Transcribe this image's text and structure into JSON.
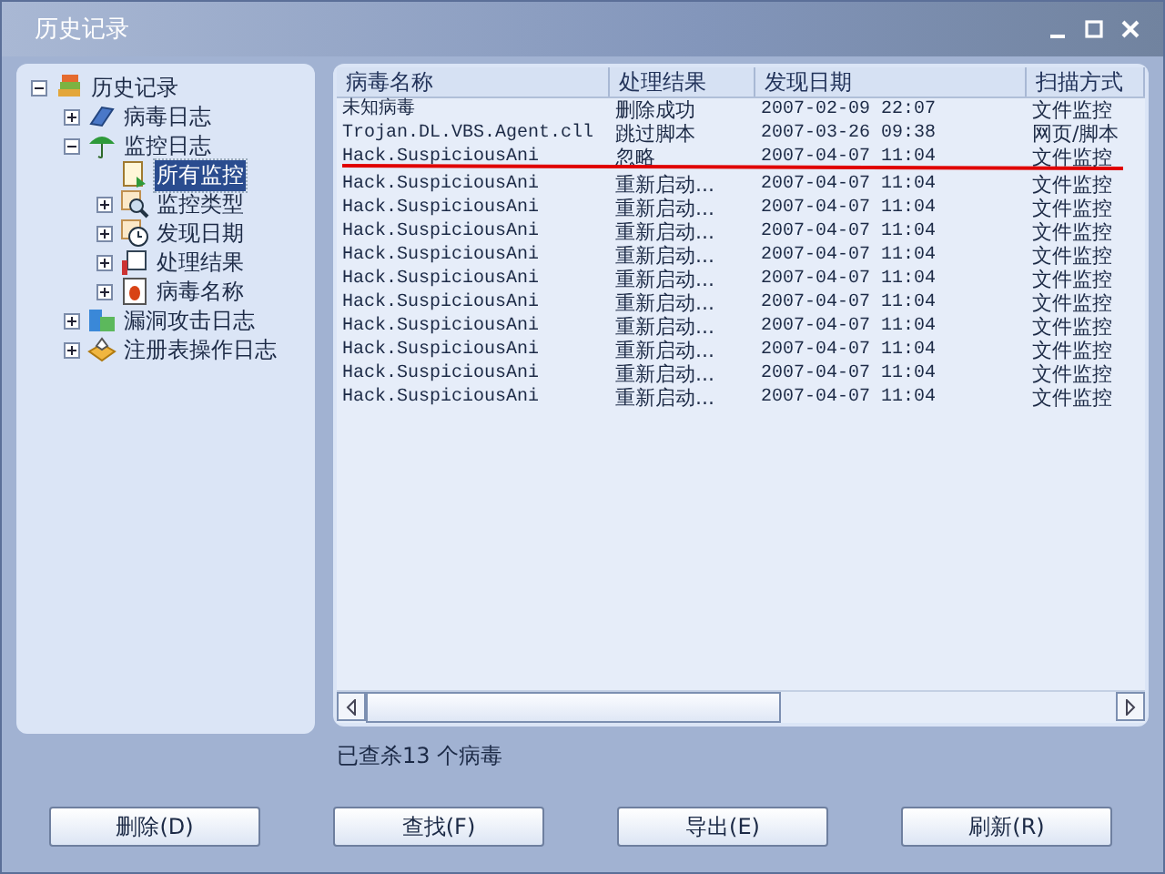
{
  "window": {
    "title": "历史记录"
  },
  "tree": [
    {
      "label": "历史记录",
      "expanded": true,
      "selected": false,
      "children": [
        {
          "label": "病毒日志",
          "expanded": false,
          "selected": false
        },
        {
          "label": "监控日志",
          "expanded": true,
          "selected": false,
          "children": [
            {
              "label": "所有监控",
              "selected": true
            },
            {
              "label": "监控类型",
              "expanded": false,
              "selected": false
            },
            {
              "label": "发现日期",
              "expanded": false,
              "selected": false
            },
            {
              "label": "处理结果",
              "expanded": false,
              "selected": false
            },
            {
              "label": "病毒名称",
              "expanded": false,
              "selected": false
            }
          ]
        },
        {
          "label": "漏洞攻击日志",
          "expanded": false,
          "selected": false
        },
        {
          "label": "注册表操作日志",
          "expanded": false,
          "selected": false
        }
      ]
    }
  ],
  "table": {
    "columns": [
      "病毒名称",
      "处理结果",
      "发现日期",
      "扫描方式"
    ],
    "rows": [
      [
        "未知病毒",
        "删除成功",
        "2007-02-09 22:07",
        "文件监控"
      ],
      [
        "Trojan.DL.VBS.Agent.cll",
        "跳过脚本",
        "2007-03-26 09:38",
        "网页/脚本"
      ],
      [
        "Hack.SuspiciousAni",
        "忽略",
        "2007-04-07 11:04",
        "文件监控"
      ],
      [
        "Hack.SuspiciousAni",
        "重新启动...",
        "2007-04-07 11:04",
        "文件监控"
      ],
      [
        "Hack.SuspiciousAni",
        "重新启动...",
        "2007-04-07 11:04",
        "文件监控"
      ],
      [
        "Hack.SuspiciousAni",
        "重新启动...",
        "2007-04-07 11:04",
        "文件监控"
      ],
      [
        "Hack.SuspiciousAni",
        "重新启动...",
        "2007-04-07 11:04",
        "文件监控"
      ],
      [
        "Hack.SuspiciousAni",
        "重新启动...",
        "2007-04-07 11:04",
        "文件监控"
      ],
      [
        "Hack.SuspiciousAni",
        "重新启动...",
        "2007-04-07 11:04",
        "文件监控"
      ],
      [
        "Hack.SuspiciousAni",
        "重新启动...",
        "2007-04-07 11:04",
        "文件监控"
      ],
      [
        "Hack.SuspiciousAni",
        "重新启动...",
        "2007-04-07 11:04",
        "文件监控"
      ],
      [
        "Hack.SuspiciousAni",
        "重新启动...",
        "2007-04-07 11:04",
        "文件监控"
      ],
      [
        "Hack.SuspiciousAni",
        "重新启动...",
        "2007-04-07 11:04",
        "文件监控"
      ]
    ]
  },
  "status": "已查杀13 个病毒",
  "buttons": [
    "删除(D)",
    "查找(F)",
    "导出(E)",
    "刷新(R)"
  ]
}
